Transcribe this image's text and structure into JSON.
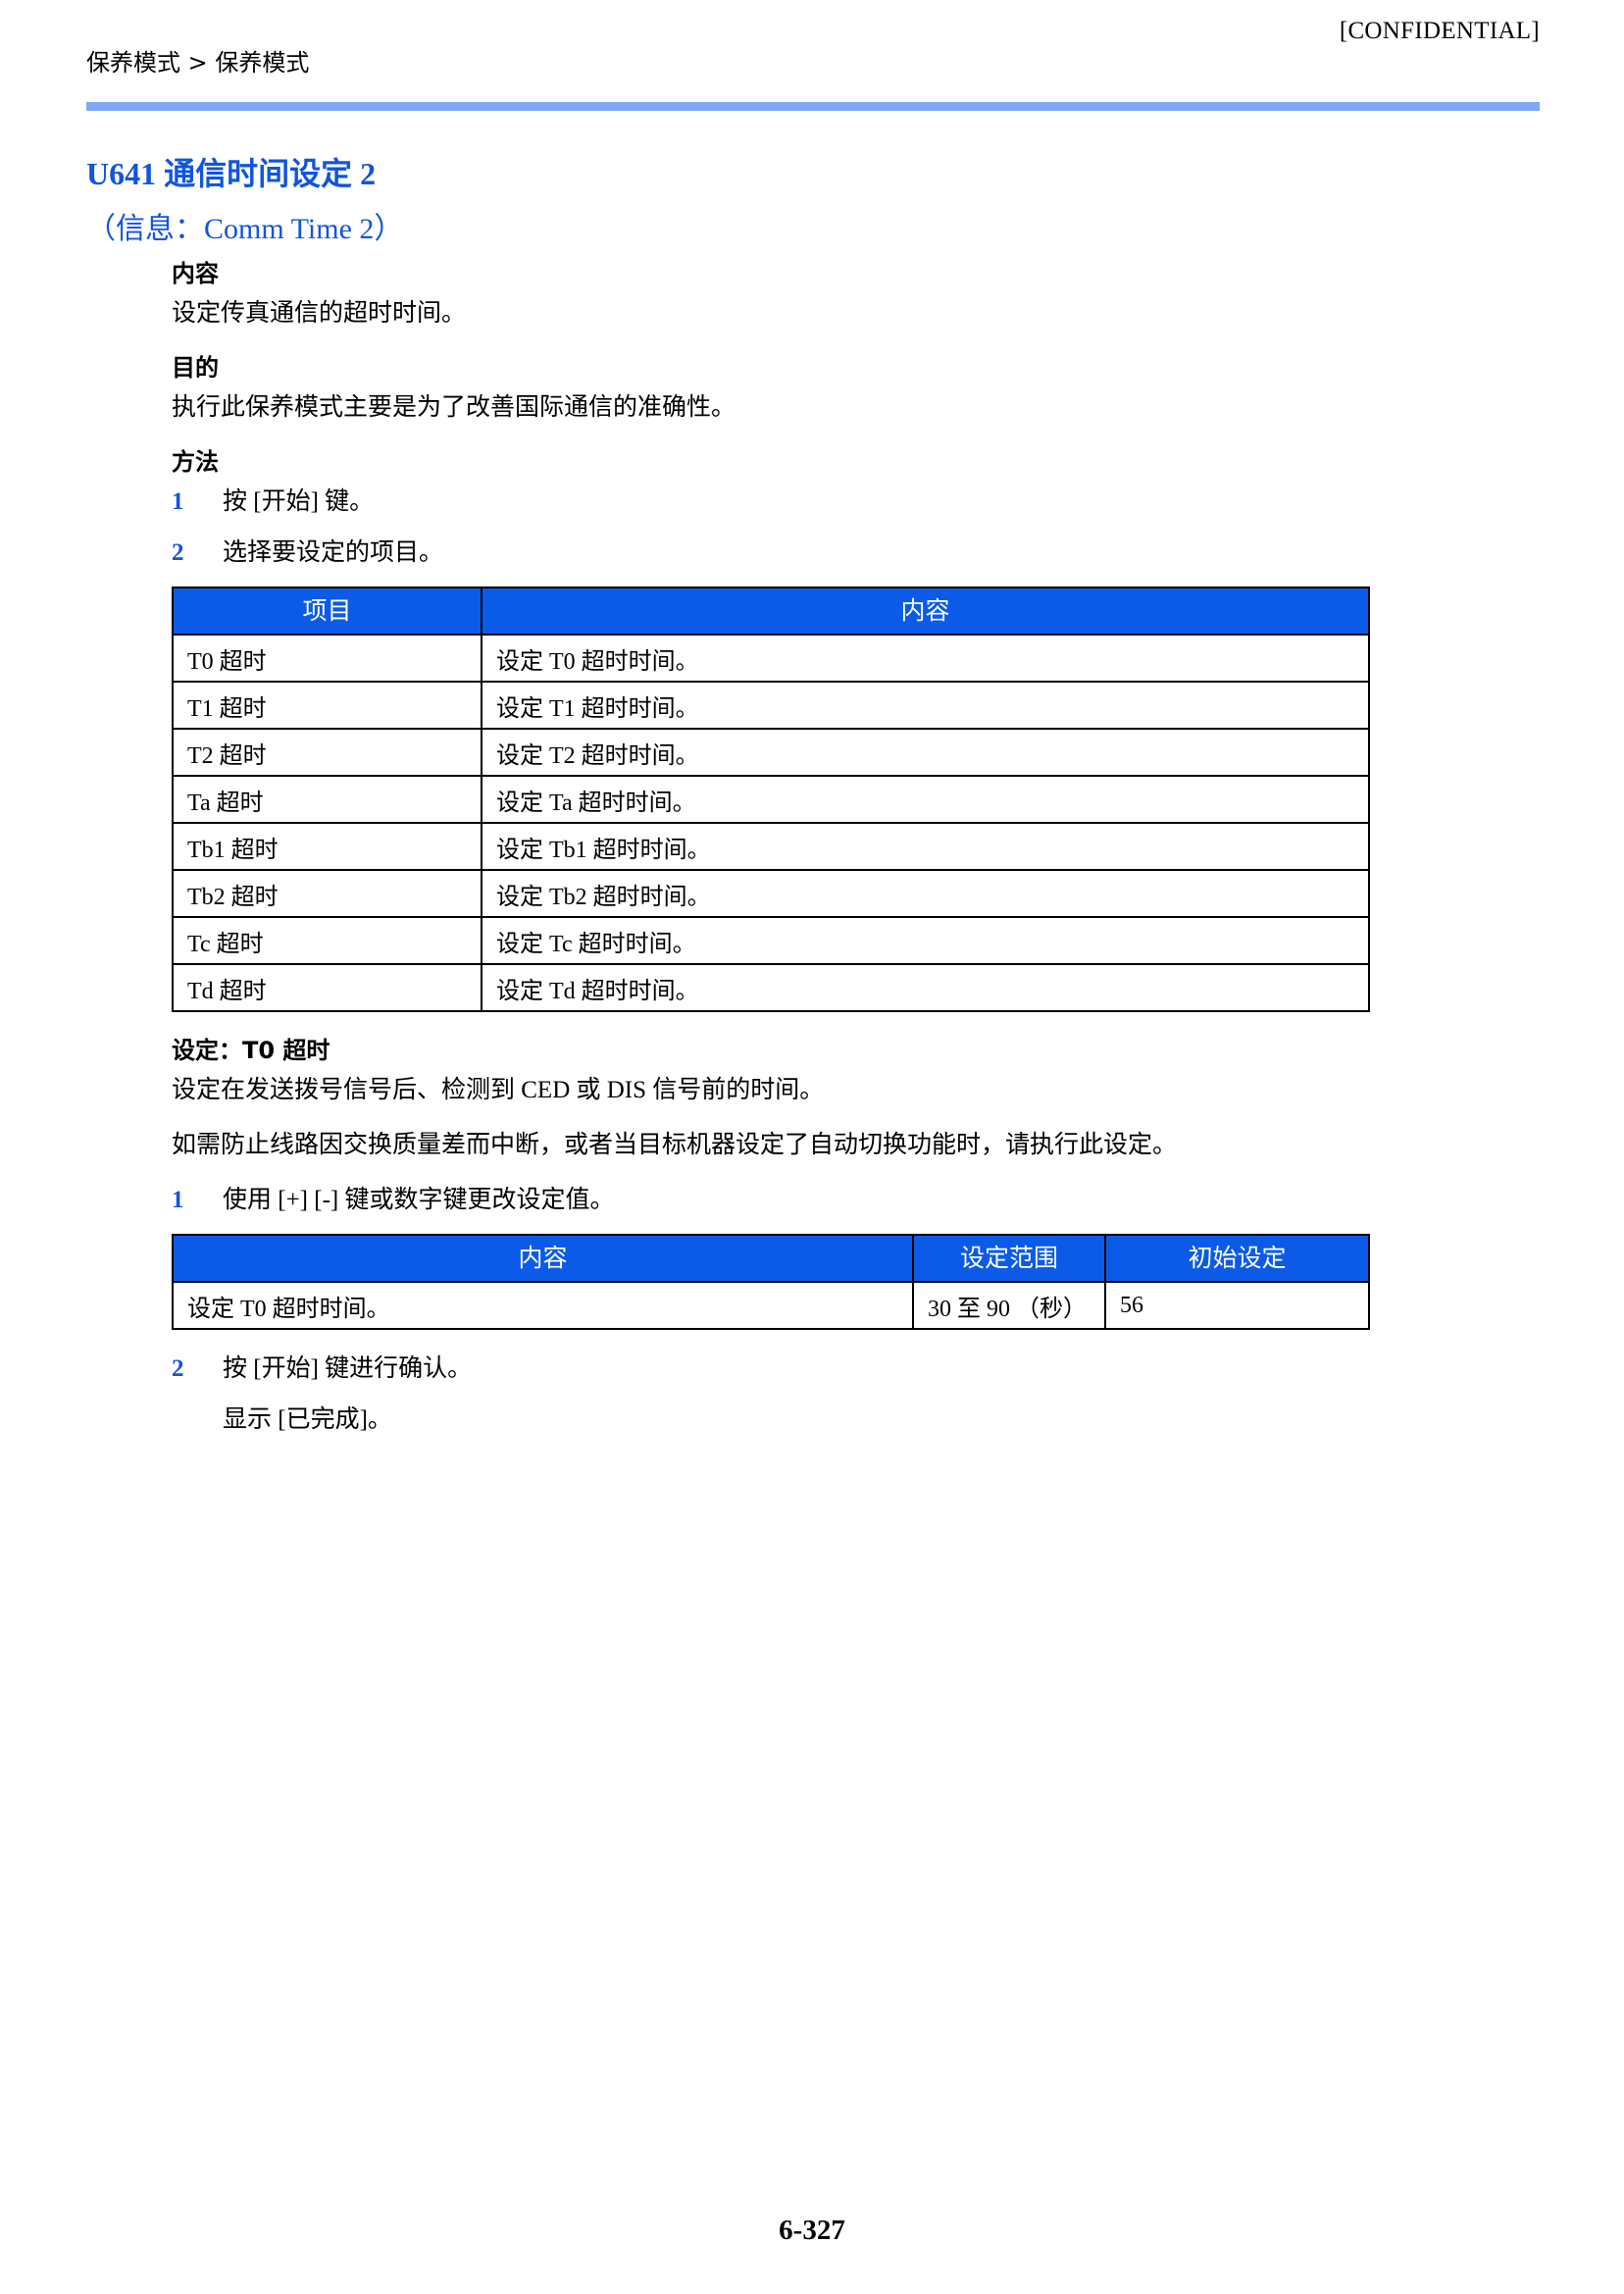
{
  "header": {
    "confidential": "[CONFIDENTIAL]",
    "breadcrumb": "保养模式 > 保养模式"
  },
  "title": {
    "main": "U641 通信时间设定 2",
    "sub": "（信息：Comm Time 2）"
  },
  "sections": {
    "content_heading": "内容",
    "content_text": "设定传真通信的超时时间。",
    "purpose_heading": "目的",
    "purpose_text": "执行此保养模式主要是为了改善国际通信的准确性。",
    "method_heading": "方法"
  },
  "steps": {
    "s1_num": "1",
    "s1_text": "按 [开始] 键。",
    "s2_num": "2",
    "s2_text": "选择要设定的项目。",
    "s3_num": "1",
    "s3_text": "使用 [+] [-] 键或数字键更改设定值。",
    "s4_num": "2",
    "s4_text": "按 [开始] 键进行确认。",
    "s4_sub": "显示 [已完成]。"
  },
  "table_items": {
    "headers": [
      "项目",
      "内容"
    ],
    "rows": [
      [
        "T0 超时",
        "设定 T0 超时时间。"
      ],
      [
        "T1 超时",
        "设定 T1 超时时间。"
      ],
      [
        "T2 超时",
        "设定 T2 超时时间。"
      ],
      [
        "Ta 超时",
        "设定 Ta 超时时间。"
      ],
      [
        "Tb1 超时",
        "设定 Tb1 超时时间。"
      ],
      [
        "Tb2 超时",
        "设定 Tb2 超时时间。"
      ],
      [
        "Tc 超时",
        "设定 Tc 超时时间。"
      ],
      [
        "Td 超时",
        "设定 Td 超时时间。"
      ]
    ]
  },
  "setting_section": {
    "heading": "设定：T0 超时",
    "para1": "设定在发送拨号信号后、检测到 CED 或 DIS 信号前的时间。",
    "para2": "如需防止线路因交换质量差而中断，或者当目标机器设定了自动切换功能时，请执行此设定。"
  },
  "table_range": {
    "headers": [
      "内容",
      "设定范围",
      "初始设定"
    ],
    "rows": [
      [
        "设定 T0 超时时间。",
        "30 至 90 （秒）",
        "56"
      ]
    ]
  },
  "footer": {
    "page_number": "6-327"
  },
  "colors": {
    "accent_blue": "#1155DD",
    "table_header_blue": "#0B5BE8",
    "rule_blue": "#7FA8F5"
  }
}
